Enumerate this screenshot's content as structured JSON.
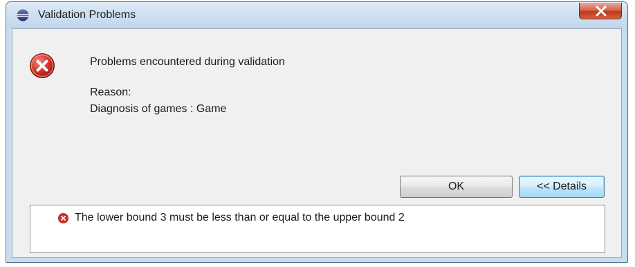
{
  "window": {
    "title": "Validation Problems",
    "app_icon": "eclipse-icon",
    "close_icon": "close-icon"
  },
  "content": {
    "error_icon": "error-icon",
    "message": "Problems encountered during validation",
    "reason_label": "Reason:",
    "reason_text": "Diagnosis of games : Game"
  },
  "buttons": {
    "ok_label": "OK",
    "details_label": "<< Details"
  },
  "details": {
    "items": [
      {
        "icon": "error-icon",
        "text": "The lower bound 3 must be less than or equal to the upper bound 2"
      }
    ]
  },
  "colors": {
    "titlebar": "#cfe0f1",
    "client_background": "#f0f0f0",
    "close_button": "#c0391c",
    "error_red": "#c8211b",
    "details_button_border": "#3c7fb1"
  }
}
